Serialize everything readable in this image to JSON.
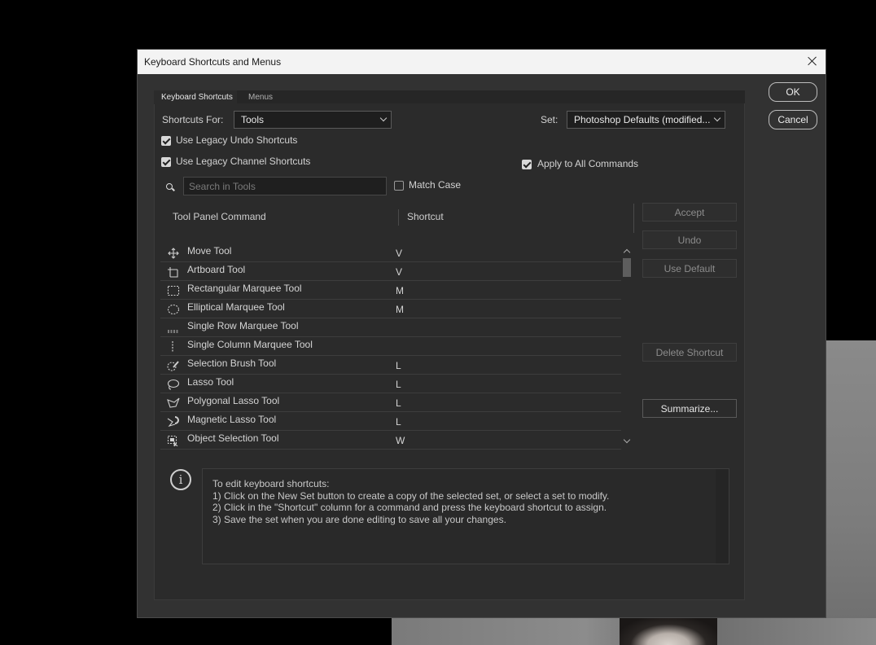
{
  "dialog": {
    "title": "Keyboard Shortcuts and Menus"
  },
  "tabs": [
    {
      "label": "Keyboard Shortcuts"
    },
    {
      "label": "Menus"
    }
  ],
  "shortcuts_for": {
    "label": "Shortcuts For:",
    "value": "Tools"
  },
  "set": {
    "label": "Set:",
    "value": "Photoshop Defaults (modified..."
  },
  "checkboxes": {
    "legacy_undo": {
      "label": "Use Legacy Undo Shortcuts",
      "checked": true
    },
    "legacy_channel": {
      "label": "Use Legacy Channel Shortcuts",
      "checked": true
    },
    "apply_all": {
      "label": "Apply to All Commands",
      "checked": true
    },
    "match_case": {
      "label": "Match Case",
      "checked": false
    }
  },
  "search": {
    "placeholder": "Search in Tools"
  },
  "table": {
    "columns": [
      "Tool Panel Command",
      "Shortcut"
    ],
    "rows": [
      {
        "icon": "move-icon",
        "name": "Move Tool",
        "key": "V"
      },
      {
        "icon": "artboard-icon",
        "name": "Artboard Tool",
        "key": "V"
      },
      {
        "icon": "rect-marquee-icon",
        "name": "Rectangular Marquee Tool",
        "key": "M"
      },
      {
        "icon": "ellipse-marquee-icon",
        "name": "Elliptical Marquee Tool",
        "key": "M"
      },
      {
        "icon": "single-row-icon",
        "name": "Single Row Marquee Tool",
        "key": ""
      },
      {
        "icon": "single-column-icon",
        "name": "Single Column Marquee Tool",
        "key": ""
      },
      {
        "icon": "selection-brush-icon",
        "name": "Selection Brush Tool",
        "key": "L"
      },
      {
        "icon": "lasso-icon",
        "name": "Lasso Tool",
        "key": "L"
      },
      {
        "icon": "polygonal-lasso-icon",
        "name": "Polygonal Lasso Tool",
        "key": "L"
      },
      {
        "icon": "magnetic-lasso-icon",
        "name": "Magnetic Lasso Tool",
        "key": "L"
      },
      {
        "icon": "object-selection-icon",
        "name": "Object Selection Tool",
        "key": "W"
      }
    ]
  },
  "side_buttons": {
    "accept": "Accept",
    "undo": "Undo",
    "use_default": "Use Default",
    "delete_shortcut": "Delete Shortcut",
    "summarize": "Summarize..."
  },
  "main_buttons": {
    "ok": "OK",
    "cancel": "Cancel"
  },
  "info": {
    "lines": [
      "To edit keyboard shortcuts:",
      "1) Click on the New Set button to create a copy of the selected set, or select a set to modify.",
      "2) Click in the \"Shortcut\" column for a command and press the keyboard shortcut to assign.",
      "3) Save the set when you are done editing to save all your changes."
    ]
  }
}
